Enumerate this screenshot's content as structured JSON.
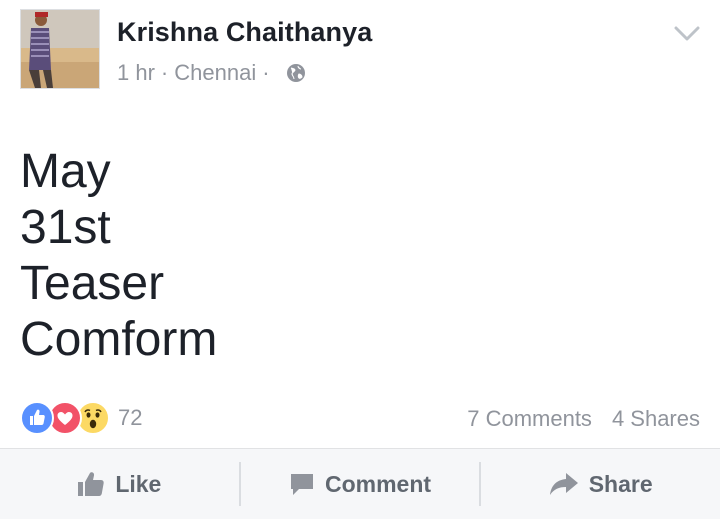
{
  "post": {
    "author": "Krishna Chaithanya",
    "time": "1 hr",
    "location": "Chennai",
    "separator": "·",
    "privacy_icon": "globe-icon",
    "menu_icon": "chevron-down-icon",
    "text_lines": [
      "May",
      "31st",
      "Teaser",
      "Comform"
    ]
  },
  "reactions": {
    "icons": [
      "like-reaction-icon",
      "love-reaction-icon",
      "wow-reaction-icon"
    ],
    "count": "72"
  },
  "stats": {
    "comments": "7 Comments",
    "shares": "4 Shares"
  },
  "actions": {
    "like_label": "Like",
    "comment_label": "Comment",
    "share_label": "Share"
  },
  "colors": {
    "like_blue": "#5890ff",
    "love_red": "#f25268",
    "wow_yellow": "#fcd964",
    "text_dark": "#1d2129",
    "text_grey": "#90949c",
    "action_bar_bg": "#f6f7f9"
  }
}
